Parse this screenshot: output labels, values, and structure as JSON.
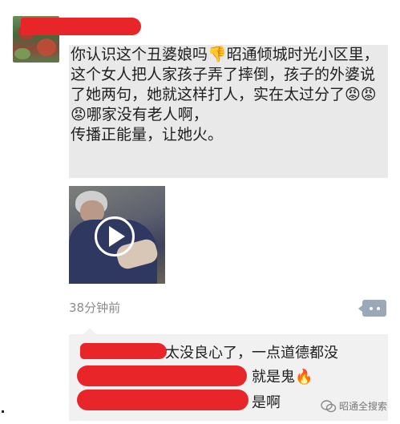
{
  "post": {
    "text": "你认识这个丑婆娘吗👎昭通倾城时光小区里，这个女人把人家孩子弄了摔倒，孩子的外婆说了她两句，她就这样打人，实在太过分了😡😡😡哪家没有老人啊，\n传播正能量，让她火。",
    "timestamp": "38分钟前"
  },
  "comments": [
    {
      "text": "太没良心了，一点道德都没"
    },
    {
      "text": "就是鬼🔥"
    },
    {
      "text": "是啊"
    }
  ],
  "watermark": {
    "label": "昭通全搜索"
  },
  "icons": {
    "comment": "comment-more-icon",
    "play": "play-icon",
    "fire": "fire-icon",
    "wechat": "wechat-logo-icon"
  },
  "colors": {
    "redaction": "#e8262a",
    "post_bg": "#e9e9ea",
    "comment_bg": "#f1f1f1",
    "timestamp": "#8b8b8b"
  }
}
